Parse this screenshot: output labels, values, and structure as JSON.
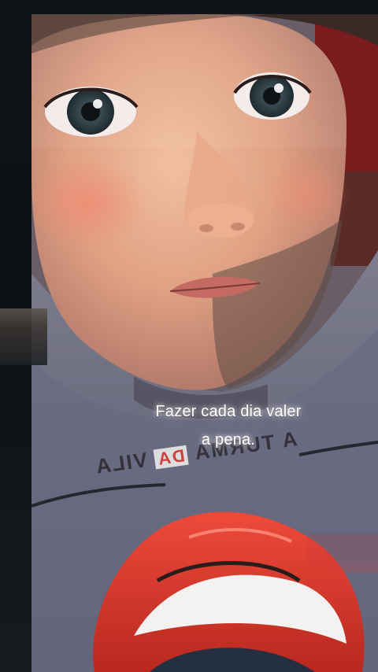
{
  "caption": {
    "line1": "Fazer cada dia valer",
    "line2": "a pena."
  },
  "shirt_print": {
    "left": "A TURMA",
    "middle": "DA",
    "right": "VILA"
  },
  "colors": {
    "background": "#0d1112",
    "skin": "#e6ad8e",
    "hoodie": "#66667c",
    "lips_red": "#d9362c",
    "caption_text": "#ffffff"
  },
  "icons": {
    "image": "face-filter-photo"
  }
}
